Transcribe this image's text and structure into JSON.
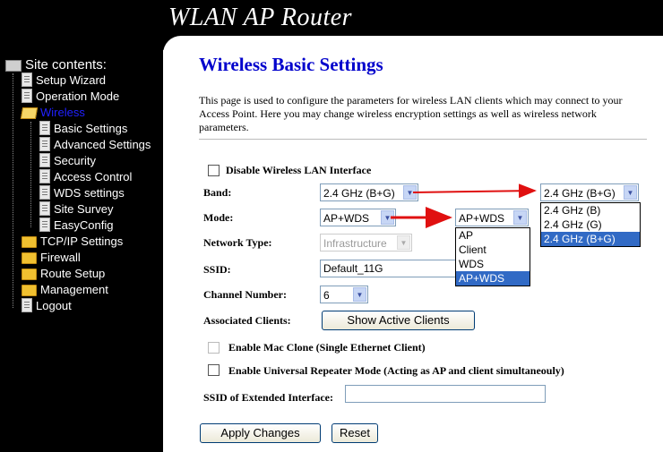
{
  "banner": {
    "title": "WLAN AP Router"
  },
  "sidebar": {
    "root": "Site contents:",
    "items": [
      {
        "label": "Setup Wizard",
        "icon": "document-icon"
      },
      {
        "label": "Operation Mode",
        "icon": "document-icon"
      },
      {
        "label": "Wireless",
        "icon": "open-folder-icon"
      },
      {
        "label": "Basic Settings",
        "icon": "document-icon"
      },
      {
        "label": "Advanced Settings",
        "icon": "document-icon"
      },
      {
        "label": "Security",
        "icon": "document-icon"
      },
      {
        "label": "Access Control",
        "icon": "document-icon"
      },
      {
        "label": "WDS settings",
        "icon": "document-icon"
      },
      {
        "label": "Site Survey",
        "icon": "document-icon"
      },
      {
        "label": "EasyConfig",
        "icon": "document-icon"
      },
      {
        "label": "TCP/IP Settings",
        "icon": "folder-icon"
      },
      {
        "label": "Firewall",
        "icon": "folder-icon"
      },
      {
        "label": "Route Setup",
        "icon": "folder-icon"
      },
      {
        "label": "Management",
        "icon": "folder-icon"
      },
      {
        "label": "Logout",
        "icon": "document-icon"
      }
    ]
  },
  "main": {
    "title": "Wireless Basic Settings",
    "description": "This page is used to configure the parameters for wireless LAN clients which may connect to your Access Point. Here you may change wireless encryption settings as well as wireless network parameters.",
    "disable_wlan_label": "Disable Wireless LAN Interface",
    "band_label": "Band:",
    "band_value": "2.4 GHz (B+G)",
    "mode_label": "Mode:",
    "mode_value": "AP+WDS",
    "network_type_label": "Network Type:",
    "network_type_value": "Infrastructure",
    "ssid_label": "SSID:",
    "ssid_value": "Default_11G",
    "channel_label": "Channel Number:",
    "channel_value": "6",
    "clients_label": "Associated Clients:",
    "show_clients_button": "Show Active Clients",
    "mac_clone_label": "Enable Mac Clone (Single Ethernet Client)",
    "repeater_label": "Enable Universal Repeater Mode (Acting as AP and client simultaneouly)",
    "ssid_ext_label": "SSID of Extended Interface:",
    "ssid_ext_value": "",
    "apply_button": "Apply Changes",
    "reset_button": "Reset"
  },
  "band_dropdown": {
    "selected": "2.4 GHz (B+G)",
    "options": [
      "2.4 GHz (B)",
      "2.4 GHz (G)",
      "2.4 GHz (B+G)"
    ],
    "highlighted_index": 2
  },
  "mode_dropdown": {
    "selected": "AP+WDS",
    "options": [
      "AP",
      "Client",
      "WDS",
      "AP+WDS"
    ],
    "highlighted_index": 3
  },
  "colors": {
    "banner_bg": "#000000",
    "title_blue": "#0000cc",
    "highlight": "#316ac5",
    "annotation_arrow": "#e01010"
  }
}
